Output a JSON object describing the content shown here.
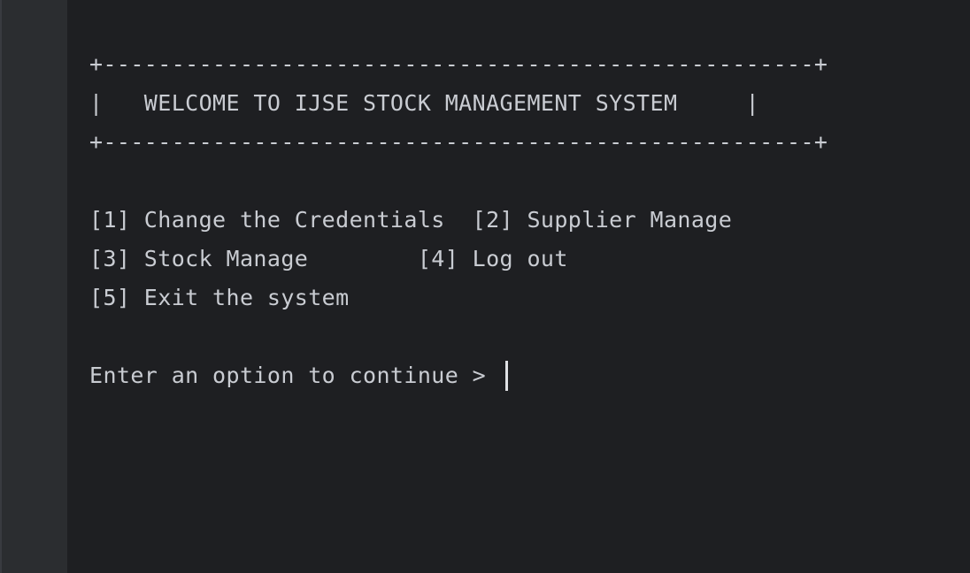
{
  "console": {
    "border_top": "+----------------------------------------------------+",
    "title_line": "|   WELCOME TO IJSE STOCK MANAGEMENT SYSTEM     |",
    "border_bottom": "+----------------------------------------------------+",
    "menu": {
      "row1": "[1] Change the Credentials  [2] Supplier Manage",
      "row2": "[3] Stock Manage        [4] Log out",
      "row3": "[5] Exit the system"
    },
    "prompt": "Enter an option to continue > "
  },
  "colors": {
    "background": "#1e1f22",
    "gutter": "#2b2d30",
    "text": "#c9ccd2",
    "cursor": "#dfe1e5"
  }
}
